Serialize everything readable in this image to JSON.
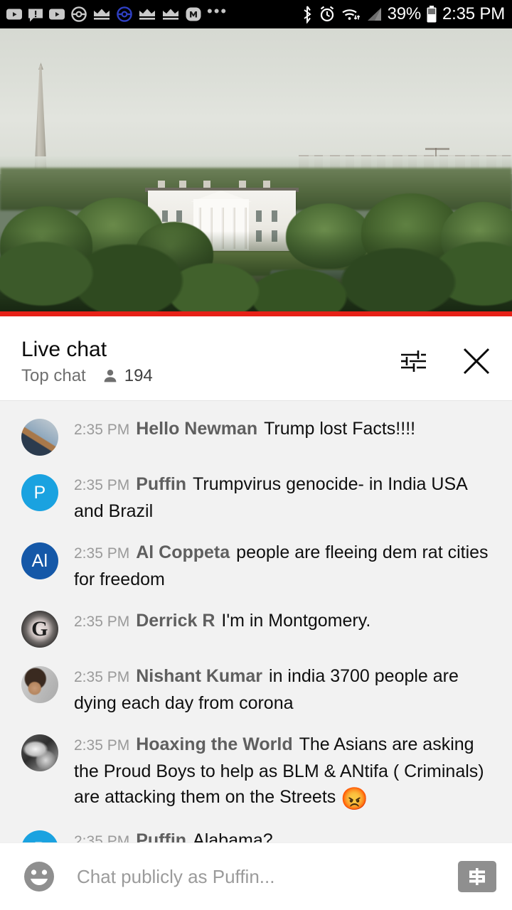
{
  "status_bar": {
    "icons": [
      {
        "name": "youtube-notification-icon"
      },
      {
        "name": "message-alert-icon"
      },
      {
        "name": "youtube-notification-icon-2"
      },
      {
        "name": "pokeball-icon"
      },
      {
        "name": "crown-icon"
      },
      {
        "name": "pokeball-blue-icon"
      },
      {
        "name": "crown-icon-2"
      },
      {
        "name": "crown-icon-3"
      },
      {
        "name": "m-badge-icon"
      }
    ],
    "more_indicator": "•••",
    "bluetooth": "bluetooth-icon",
    "alarm": "alarm-icon",
    "wifi": "wifi-icon",
    "signal": "cellular-signal-icon",
    "battery_percent": "39%",
    "battery": "battery-icon",
    "clock": "2:35 PM",
    "background_color": "#000000",
    "text_color": "#ffffff"
  },
  "video": {
    "name": "live-video-player",
    "description": "Live aerial view of the White House with the Washington Monument",
    "progress_percent": 100,
    "progress_color": "#e62117"
  },
  "chat_header": {
    "title": "Live chat",
    "mode": "Top chat",
    "viewer_icon": "person-icon",
    "viewer_count": "194",
    "settings_icon": "chat-settings-sliders-icon",
    "close_icon": "close-icon"
  },
  "messages": [
    {
      "time": "2:35 PM",
      "author": "Hello Newman",
      "text": "Trump lost Facts!!!!",
      "avatar_type": "photo-a",
      "avatar_letter": ""
    },
    {
      "time": "2:35 PM",
      "author": "Puffin",
      "text": "Trumpvirus genocide- in India USA and Brazil",
      "avatar_type": "letter-blue",
      "avatar_letter": "P"
    },
    {
      "time": "2:35 PM",
      "author": "Al Coppeta",
      "text": "people are fleeing dem rat cities for freedom",
      "avatar_type": "letter-navy",
      "avatar_letter": "Al"
    },
    {
      "time": "2:35 PM",
      "author": "Derrick R",
      "text": "I'm in Montgomery.",
      "avatar_type": "photo-g",
      "avatar_letter": ""
    },
    {
      "time": "2:35 PM",
      "author": "Nishant Kumar",
      "text": "in india 3700 people are dying each day from corona",
      "avatar_type": "photo-person",
      "avatar_letter": ""
    },
    {
      "time": "2:35 PM",
      "author": "Hoaxing the World",
      "text": "The Asians are asking the Proud Boys to help as BLM & ANtifa ( Criminals) are attacking them on the Streets ",
      "emoji": "😡",
      "avatar_type": "photo-gray",
      "avatar_letter": ""
    },
    {
      "time": "2:35 PM",
      "author": "Puffin",
      "text": "Alabama?",
      "avatar_type": "letter-blue",
      "avatar_letter": "P"
    }
  ],
  "input_bar": {
    "emoji_icon": "emoji-smiley-icon",
    "placeholder": "Chat publicly as Puffin...",
    "value": "",
    "superchat_icon": "super-chat-dollar-icon"
  },
  "colors": {
    "accent_red": "#e62117",
    "chat_bg": "#f2f2f2",
    "panel_bg": "#ffffff",
    "author_text": "#5f6368",
    "timestamp_text": "#9a9a9a"
  }
}
